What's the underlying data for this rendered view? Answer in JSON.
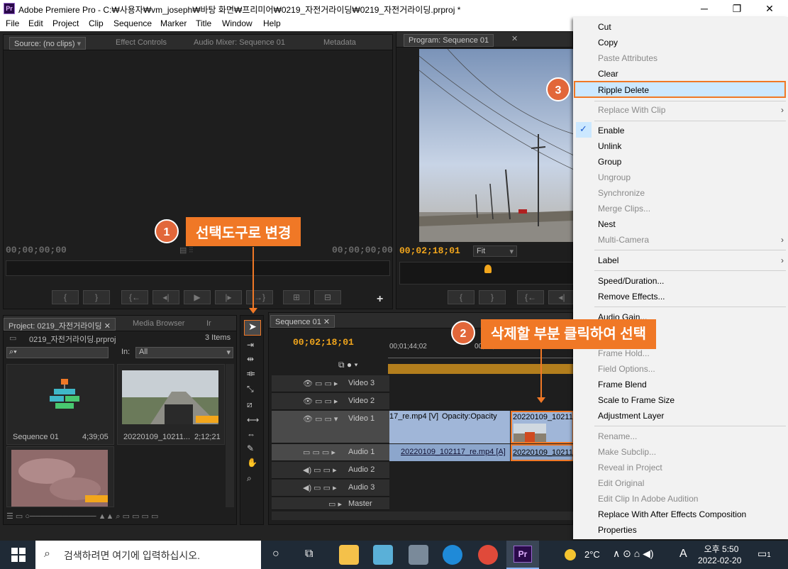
{
  "window": {
    "title": "Adobe Premiere Pro - C:₩사용자₩vm_joseph₩바탕 화면₩프리미어₩0219_자전거라이딩₩0219_자전거라이딩.prproj *",
    "app_icon": "Pr",
    "min": "─",
    "max": "❐",
    "close": "✕"
  },
  "menu": [
    "File",
    "Edit",
    "Project",
    "Clip",
    "Sequence",
    "Marker",
    "Title",
    "Window",
    "Help"
  ],
  "source_panel": {
    "tabs": [
      "Source: (no clips)",
      "Effect Controls",
      "Audio Mixer: Sequence 01",
      "Metadata"
    ],
    "timecode_left": "00;00;00;00",
    "timecode_right": "00;00;00;00"
  },
  "program_panel": {
    "tab": "Program: Sequence 01",
    "timecode": "00;02;18;01",
    "fit": "Fit"
  },
  "project_panel": {
    "tabs": [
      "Project: 0219_자전거라이딩",
      "Media Browser",
      "Ir"
    ],
    "file": "0219_자전거라이딩.prproj",
    "items_count": "3 Items",
    "in_label": "In:",
    "in_value": "All",
    "items": [
      {
        "name": "Sequence 01",
        "duration": "4;39;05"
      },
      {
        "name": "20220109_10211...",
        "duration": "2;12;21"
      }
    ]
  },
  "timeline": {
    "tab": "Sequence 01",
    "timecode": "00;02;18;01",
    "ruler_left": "00;01;44;02",
    "ruler_right": "00;01;5",
    "tracks": [
      "Video 3",
      "Video 2",
      "Video 1",
      "Audio 1",
      "Audio 2",
      "Audio 3",
      "Master"
    ],
    "clip_v1_left": "17_re.mp4 [V]",
    "clip_v1_opacity": "Opacity:Opacity",
    "clip_v1_right": "20220109_10211",
    "clip_a1_left": "20220109_102117_re.mp4 [A]",
    "clip_a1_right": "20220109_10211"
  },
  "context_menu": {
    "items": [
      {
        "label": "Cut",
        "enabled": true
      },
      {
        "label": "Copy",
        "enabled": true
      },
      {
        "label": "Paste Attributes",
        "enabled": false
      },
      {
        "label": "Clear",
        "enabled": true
      },
      {
        "label": "Ripple Delete",
        "enabled": true,
        "highlighted": true
      },
      {
        "label": "Replace With Clip",
        "enabled": false,
        "submenu": true
      },
      {
        "label": "Enable",
        "enabled": true,
        "checked": true
      },
      {
        "label": "Unlink",
        "enabled": true
      },
      {
        "label": "Group",
        "enabled": true
      },
      {
        "label": "Ungroup",
        "enabled": false
      },
      {
        "label": "Synchronize",
        "enabled": false
      },
      {
        "label": "Merge Clips...",
        "enabled": false
      },
      {
        "label": "Nest",
        "enabled": true
      },
      {
        "label": "Multi-Camera",
        "enabled": false,
        "submenu": true
      },
      {
        "label": "Label",
        "enabled": true,
        "submenu": true
      },
      {
        "label": "Speed/Duration...",
        "enabled": true
      },
      {
        "label": "Remove Effects...",
        "enabled": true
      },
      {
        "label": "Audio Gain...",
        "enabled": true
      },
      {
        "label": "Frame Hold...",
        "enabled": false
      },
      {
        "label": "Field Options...",
        "enabled": false
      },
      {
        "label": "Frame Blend",
        "enabled": true
      },
      {
        "label": "Scale to Frame Size",
        "enabled": true
      },
      {
        "label": "Adjustment Layer",
        "enabled": true
      },
      {
        "label": "Rename...",
        "enabled": false
      },
      {
        "label": "Make Subclip...",
        "enabled": false
      },
      {
        "label": "Reveal in Project",
        "enabled": false
      },
      {
        "label": "Edit Original",
        "enabled": false
      },
      {
        "label": "Edit Clip In Adobe Audition",
        "enabled": false
      },
      {
        "label": "Replace With After Effects Composition",
        "enabled": true
      },
      {
        "label": "Properties",
        "enabled": true
      }
    ]
  },
  "callouts": [
    {
      "num": "1",
      "text": "선택도구로 변경"
    },
    {
      "num": "2",
      "text": "삭제할 부분 클릭하여 선택"
    },
    {
      "num": "3",
      "text": ""
    }
  ],
  "taskbar": {
    "search_placeholder": "검색하려면 여기에 입력하십시오.",
    "weather": "2°C",
    "ime": "A",
    "time": "오후 5:50",
    "date": "2022-02-20",
    "notification_count": "1",
    "premiere_icon": "Pr"
  },
  "colors": {
    "accent": "#f07826",
    "timecode": "#f2a61c",
    "highlight": "#cce8ff"
  }
}
